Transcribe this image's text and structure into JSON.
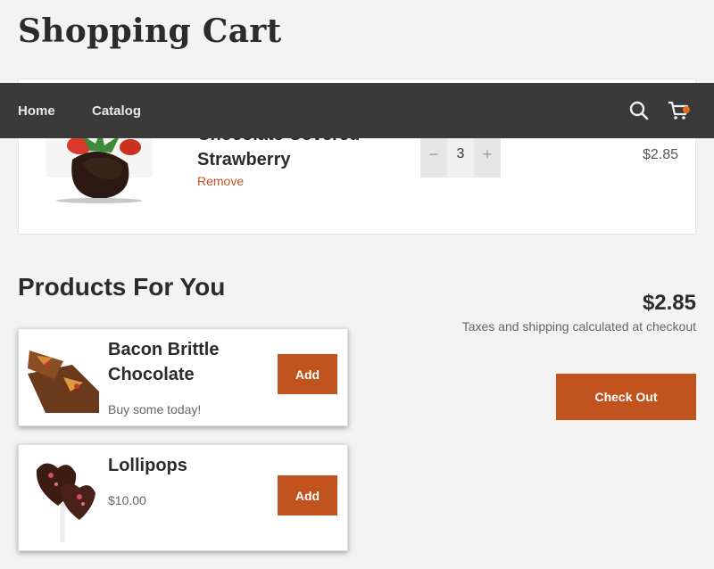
{
  "page": {
    "title": "Shopping Cart"
  },
  "nav": {
    "items": [
      {
        "label": "Home"
      },
      {
        "label": "Catalog"
      }
    ],
    "search_icon": "search-icon",
    "cart_icon": "cart-icon",
    "cart_dot_color": "#e56b1f"
  },
  "cart": {
    "item": {
      "name": "Chocolate Covered Strawberry",
      "remove_label": "Remove",
      "quantity": "3",
      "decrement_label": "−",
      "increment_label": "+",
      "price": "$2.85"
    }
  },
  "recommendations": {
    "title": "Products For You",
    "items": [
      {
        "name": "Bacon Brittle Chocolate",
        "subtitle": "Buy some today!",
        "add_label": "Add"
      },
      {
        "name": "Lollipops",
        "subtitle": "$10.00",
        "add_label": "Add"
      }
    ]
  },
  "summary": {
    "subtotal": "$2.85",
    "tax_note": "Taxes and shipping calculated at checkout",
    "checkout_label": "Check Out"
  },
  "colors": {
    "accent": "#c1531f",
    "navbar": "#3a3a3a",
    "background": "#f3f3f3"
  }
}
